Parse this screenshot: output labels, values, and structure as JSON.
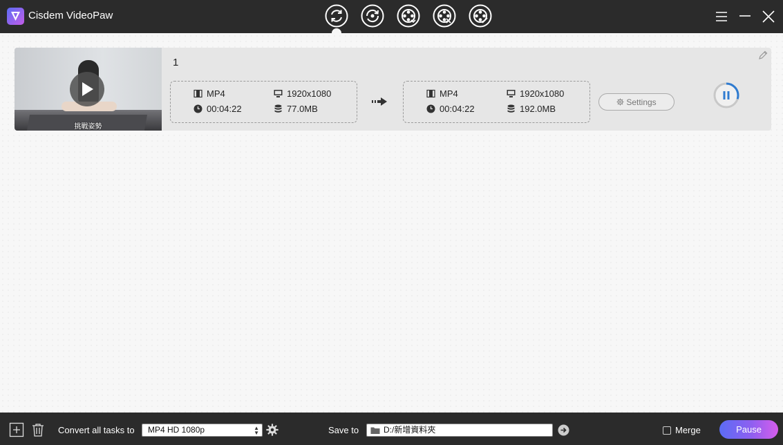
{
  "app": {
    "title": "Cisdem VideoPaw"
  },
  "toolbar": {
    "modes": [
      {
        "name": "convert",
        "icon": "convert-icon"
      },
      {
        "name": "rotate",
        "icon": "rotate-icon"
      },
      {
        "name": "reel-download",
        "icon": "film-reel-download-icon"
      },
      {
        "name": "reel-compress",
        "icon": "film-reel-compress-icon"
      },
      {
        "name": "reel-edit",
        "icon": "film-reel-edit-icon"
      }
    ]
  },
  "task": {
    "name": "1",
    "thumbnail_caption": "挑戰姿勢",
    "source": {
      "format": "MP4",
      "resolution": "1920x1080",
      "duration": "00:04:22",
      "size": "77.0MB"
    },
    "output": {
      "format": "MP4",
      "resolution": "1920x1080",
      "duration": "00:04:22",
      "size": "192.0MB"
    },
    "settings_label": "Settings",
    "progress": 0.3
  },
  "bottom": {
    "convert_label": "Convert all tasks to",
    "format_value": "MP4 HD 1080p",
    "save_label": "Save to",
    "save_path": "D:/新增資料夾",
    "merge_label": "Merge",
    "pause_label": "Pause"
  },
  "colors": {
    "titlebar": "#2b2b2b",
    "accent_start": "#5b6cf5",
    "accent_end": "#d65dec",
    "progress": "#2f7bd0"
  }
}
